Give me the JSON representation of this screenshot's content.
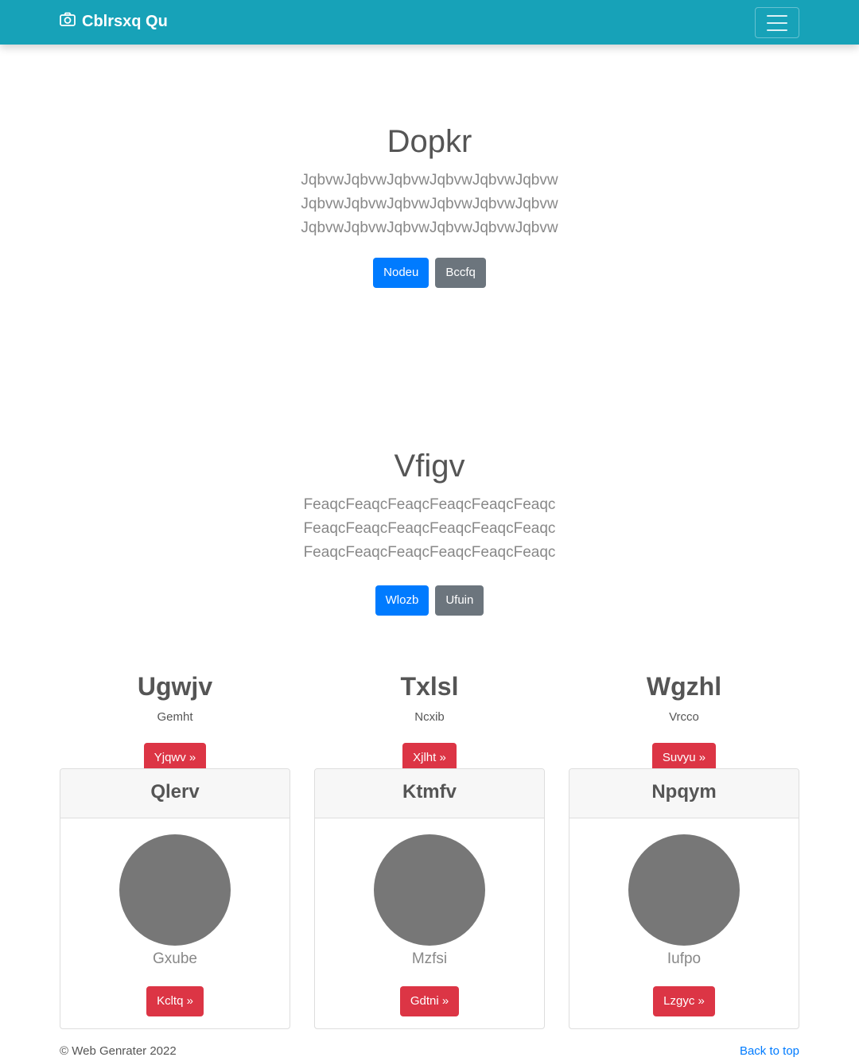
{
  "navbar": {
    "brand": "Cblrsxq Qu",
    "brand_icon": "camera-icon",
    "toggler_icon": "hamburger-menu-icon",
    "bg_color": "#17a2b8"
  },
  "hero1": {
    "title": "Dopkr",
    "lead": "JqbvwJqbvwJqbvwJqbvwJqbvwJqbvw JqbvwJqbvwJqbvwJqbvwJqbvwJqbvw JqbvwJqbvwJqbvwJqbvwJqbvwJqbvw",
    "primary_label": "Nodeu",
    "secondary_label": "Bccfq"
  },
  "hero2": {
    "title": "Vfigv",
    "lead": "FeaqcFeaqcFeaqcFeaqcFeaqcFeaqc FeaqcFeaqcFeaqcFeaqcFeaqcFeaqc FeaqcFeaqcFeaqcFeaqcFeaqcFeaqc",
    "primary_label": "Wlozb",
    "secondary_label": "Ufuin"
  },
  "features": [
    {
      "title": "Ugwjv",
      "text": "Gemht",
      "button": "Yjqwv »"
    },
    {
      "title": "Txlsl",
      "text": "Ncxib",
      "button": "Xjlht »"
    },
    {
      "title": "Wgzhl",
      "text": "Vrcco",
      "button": "Suvyu »"
    }
  ],
  "cards": [
    {
      "header": "Qlerv",
      "name": "Gxube",
      "button": "Kcltq »"
    },
    {
      "header": "Ktmfv",
      "name": "Mzfsi",
      "button": "Gdtni »"
    },
    {
      "header": "Npqym",
      "name": "Iufpo",
      "button": "Lzgyc »"
    }
  ],
  "footer": {
    "copyright": "© Web Genrater 2022",
    "back_to_top": "Back to top"
  },
  "colors": {
    "primary": "#007bff",
    "secondary": "#6c757d",
    "danger": "#dc3545",
    "link": "#007bff"
  }
}
